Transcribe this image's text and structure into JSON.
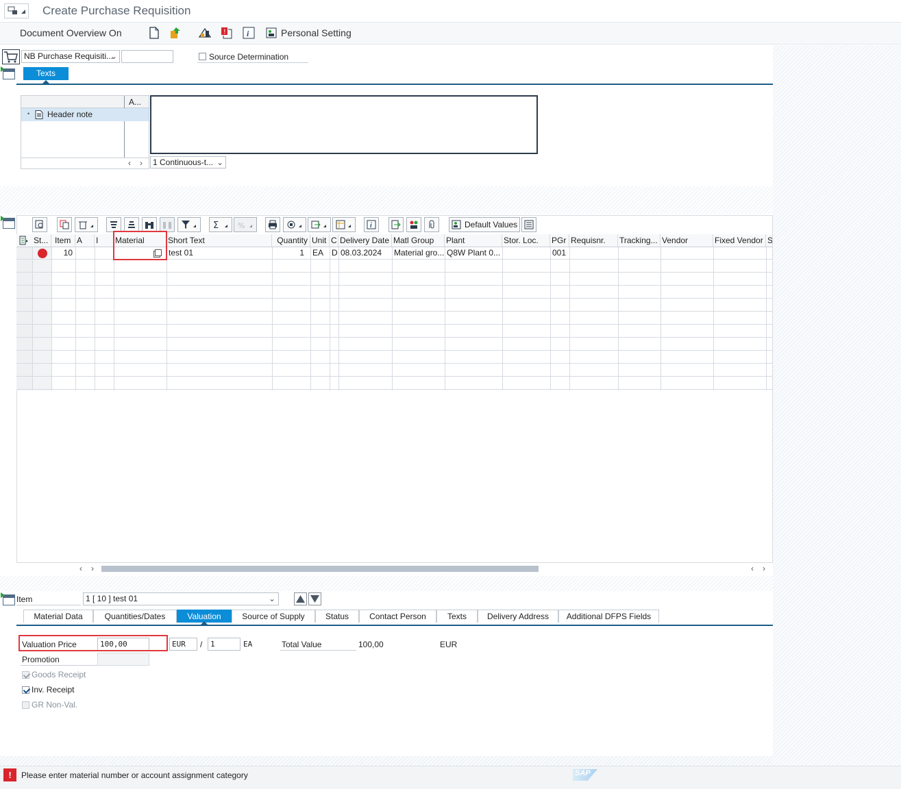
{
  "title_bar": {
    "title": "Create Purchase Requisition"
  },
  "app_toolbar": {
    "document_overview": "Document Overview On",
    "personal_setting": "Personal Setting"
  },
  "header": {
    "doc_type": "NB Purchase Requisiti...",
    "doc_number": "",
    "source_determination": "Source Determination",
    "tab_texts": "Texts",
    "text_col_header": "A...",
    "header_note": "Header note",
    "text_format": "1 Continuous-t..."
  },
  "grid_toolbar": {
    "default_values": "Default Values"
  },
  "grid": {
    "columns": [
      "St...",
      "Item",
      "A",
      "I",
      "Material",
      "Short Text",
      "Quantity",
      "Unit",
      "C",
      "Delivery Date",
      "Matl Group",
      "Plant",
      "Stor. Loc.",
      "PGr",
      "Requisnr.",
      "Tracking...",
      "Vendor",
      "Fixed Vendor",
      "S"
    ],
    "row": {
      "item": "10",
      "short_text": "test 01",
      "quantity": "1",
      "unit": "EA",
      "c": "D",
      "delivery_date": "08.03.2024",
      "matl_group": "Material gro...",
      "plant": "Q8W Plant 0...",
      "pgr": "001"
    }
  },
  "item_detail": {
    "label": "Item",
    "selector": "1 [ 10 ] test 01",
    "tabs": [
      "Material Data",
      "Quantities/Dates",
      "Valuation",
      "Source of Supply",
      "Status",
      "Contact Person",
      "Texts",
      "Delivery Address",
      "Additional DFPS Fields"
    ],
    "active_tab": "Valuation",
    "valuation_price_label": "Valuation Price",
    "valuation_price": "100,00",
    "currency": "EUR",
    "per_slash": "/",
    "per": "1",
    "per_unit": "EA",
    "total_value_label": "Total Value",
    "total_value": "100,00",
    "total_currency": "EUR",
    "promotion_label": "Promotion",
    "goods_receipt": "Goods Receipt",
    "inv_receipt": "Inv. Receipt",
    "gr_nonval": "GR Non-Val."
  },
  "status_bar": {
    "message": "Please enter material number or account assignment category",
    "logo": "SAP"
  },
  "colors": {
    "accent": "#0b8dd8",
    "error": "#d9252c",
    "highlight": "#e0383e"
  }
}
